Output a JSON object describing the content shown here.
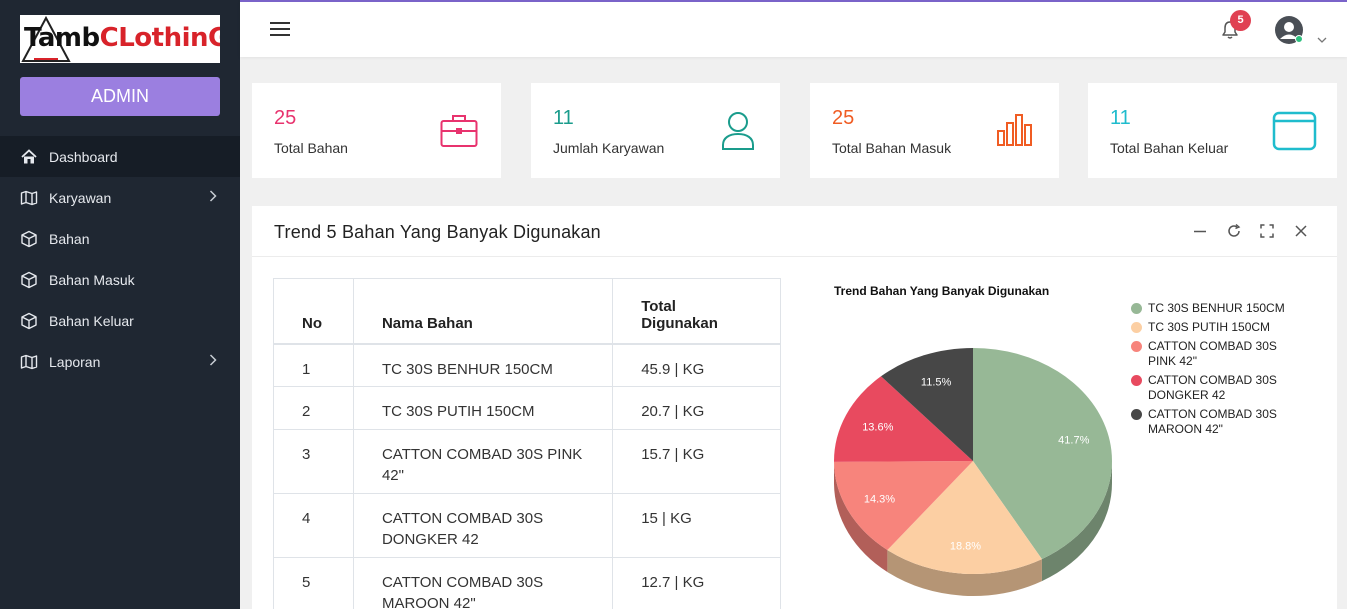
{
  "brand": {
    "logo_part1": "Tamb",
    "logo_part2": "CLothinG",
    "role_button": "ADMIN"
  },
  "sidebar": {
    "items": [
      {
        "label": "Dashboard",
        "icon": "home-icon",
        "active": true
      },
      {
        "label": "Karyawan",
        "icon": "map-icon",
        "has_submenu": true
      },
      {
        "label": "Bahan",
        "icon": "box-icon"
      },
      {
        "label": "Bahan Masuk",
        "icon": "box-icon"
      },
      {
        "label": "Bahan Keluar",
        "icon": "box-icon"
      },
      {
        "label": "Laporan",
        "icon": "map-icon",
        "has_submenu": true
      }
    ]
  },
  "topbar": {
    "notification_count": "5"
  },
  "stats": [
    {
      "value": "25",
      "label": "Total Bahan",
      "color": "#e8336e",
      "icon": "briefcase-icon"
    },
    {
      "value": "11",
      "label": "Jumlah Karyawan",
      "color": "#1a9c8c",
      "icon": "user-icon"
    },
    {
      "value": "25",
      "label": "Total Bahan Masuk",
      "color": "#f05c23",
      "icon": "bar-chart-icon"
    },
    {
      "value": "11",
      "label": "Total Bahan Keluar",
      "color": "#1fbccd",
      "icon": "window-icon"
    }
  ],
  "panel": {
    "title": "Trend 5 Bahan Yang Banyak Digunakan",
    "table": {
      "headers": [
        "No",
        "Nama Bahan",
        "Total Digunakan"
      ],
      "rows": [
        [
          "1",
          "TC 30S BENHUR 150CM",
          "45.9 | KG"
        ],
        [
          "2",
          "TC 30S PUTIH 150CM",
          "20.7 | KG"
        ],
        [
          "3",
          "CATTON COMBAD 30S PINK 42\"",
          "15.7 | KG"
        ],
        [
          "4",
          "CATTON COMBAD 30S DONGKER 42",
          "15 | KG"
        ],
        [
          "5",
          "CATTON COMBAD 30S MAROON 42\"",
          "12.7 | KG"
        ]
      ]
    }
  },
  "chart_data": {
    "type": "pie",
    "title": "Trend Bahan Yang Banyak Digunakan",
    "categories": [
      "TC 30S BENHUR 150CM",
      "TC 30S PUTIH 150CM",
      "CATTON COMBAD 30S PINK 42\"",
      "CATTON COMBAD 30S DONGKER 42",
      "CATTON COMBAD 30S MAROON 42\""
    ],
    "values": [
      41.7,
      18.8,
      14.3,
      13.6,
      11.5
    ],
    "labels": [
      "41.7%",
      "18.8%",
      "14.3%",
      "13.6%",
      "11.5%"
    ],
    "colors": [
      "#97b896",
      "#fccfa3",
      "#f7847c",
      "#e84a5f",
      "#474747"
    ],
    "legend_position": "right",
    "style": "3d"
  }
}
